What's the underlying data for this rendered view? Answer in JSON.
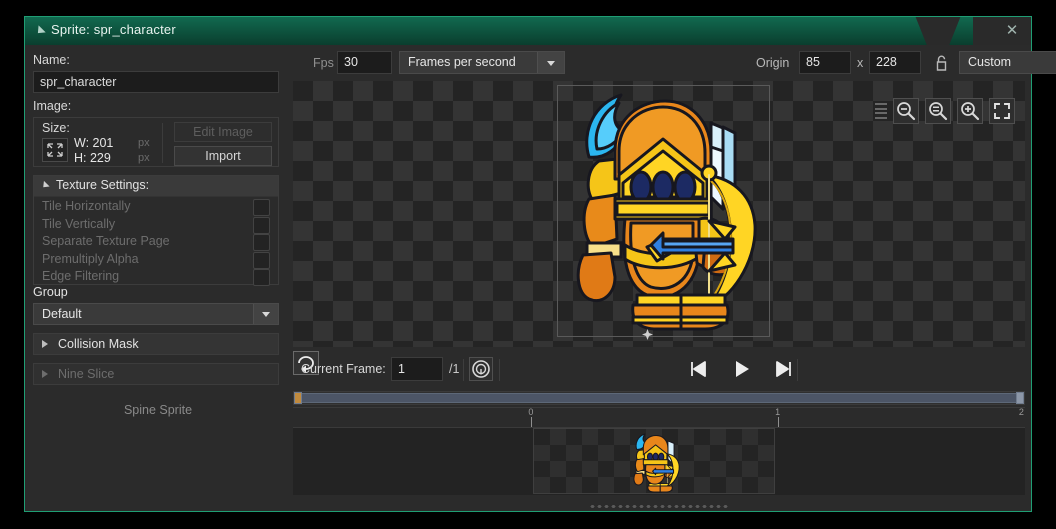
{
  "window": {
    "title": "Sprite: spr_character",
    "close_label": "✕",
    "accent_color": "#1f9e74",
    "titlebar_color": "#0c4b3a"
  },
  "left_panel": {
    "name_label": "Name:",
    "name_value": "spr_character",
    "image_label": "Image:",
    "size": {
      "title": "Size:",
      "width_label": "W: 201",
      "height_label": "H: 229",
      "width_unit": "px",
      "height_unit": "px"
    },
    "edit_image_label": "Edit Image",
    "import_label": "Import",
    "texture_settings": {
      "title": "Texture Settings:",
      "options": [
        {
          "label": "Tile Horizontally",
          "checked": false
        },
        {
          "label": "Tile Vertically",
          "checked": false
        },
        {
          "label": "Separate Texture Page",
          "checked": false
        },
        {
          "label": "Premultiply Alpha",
          "checked": false
        },
        {
          "label": "Edge Filtering",
          "checked": false
        }
      ],
      "group_label": "Group",
      "group_value": "Default"
    },
    "collision_mask_label": "Collision Mask",
    "nine_slice_label": "Nine Slice",
    "spine_sprite_label": "Spine Sprite"
  },
  "toolbar": {
    "fps_label": "Fps",
    "fps_value": "30",
    "fps_mode_value": "Frames per second",
    "origin_label": "Origin",
    "origin_x": "85",
    "origin_separator": "x",
    "origin_y": "228",
    "origin_preset_value": "Custom"
  },
  "canvas": {
    "zoom_out_icon": "zoom-out-icon",
    "zoom_reset_icon": "zoom-reset-icon",
    "zoom_in_icon": "zoom-in-icon",
    "fit_icon": "fit-to-screen-icon"
  },
  "playback": {
    "current_frame_label": "Current Frame:",
    "current_frame_value": "1",
    "total_frames_label": "/1",
    "onion_skin_icon": "onion-skin-icon",
    "prev_frame_icon": "skip-previous-icon",
    "play_icon": "play-icon",
    "next_frame_icon": "skip-next-icon",
    "loop_icon": "loop-icon"
  },
  "timeline": {
    "ticks": [
      {
        "label": "0",
        "pos_pct": 32.5
      },
      {
        "label": "1",
        "pos_pct": 66.2
      },
      {
        "label": "2",
        "pos_pct": 99.5
      }
    ]
  },
  "frames": {
    "count": 1
  }
}
